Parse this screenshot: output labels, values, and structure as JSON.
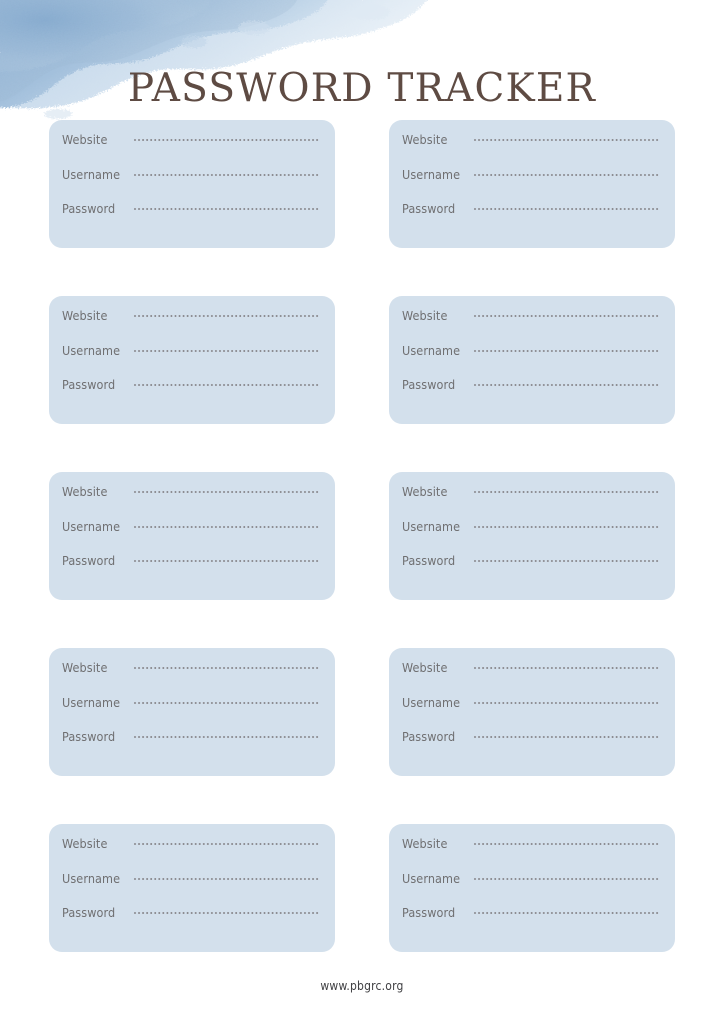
{
  "page": {
    "title": "PASSWORD TRACKER",
    "background_color": "#ffffff",
    "title_color": "#5e4b43"
  },
  "decoration": {
    "watercolor_splash": {
      "name": "watercolor-splash",
      "colors": [
        "#8cafd2",
        "#a8c3de",
        "#c6d9ea",
        "#e2ecf5"
      ],
      "position": "top-left"
    }
  },
  "card_style": {
    "background_color": "#d3e0ec",
    "label_color": "#6f6f71",
    "dot_color": "#8b8b90"
  },
  "field_labels": {
    "website": "Website",
    "username": "Username",
    "password": "Password"
  },
  "field_values": {
    "website": "",
    "username": "",
    "password": ""
  },
  "rows": [
    {
      "cards": [
        {
          "fields": [
            {
              "label": "Website",
              "value": ""
            },
            {
              "label": "Username",
              "value": ""
            },
            {
              "label": "Password",
              "value": ""
            }
          ]
        },
        {
          "fields": [
            {
              "label": "Website",
              "value": ""
            },
            {
              "label": "Username",
              "value": ""
            },
            {
              "label": "Password",
              "value": ""
            }
          ]
        }
      ]
    },
    {
      "cards": [
        {
          "fields": [
            {
              "label": "Website",
              "value": ""
            },
            {
              "label": "Username",
              "value": ""
            },
            {
              "label": "Password",
              "value": ""
            }
          ]
        },
        {
          "fields": [
            {
              "label": "Website",
              "value": ""
            },
            {
              "label": "Username",
              "value": ""
            },
            {
              "label": "Password",
              "value": ""
            }
          ]
        }
      ]
    },
    {
      "cards": [
        {
          "fields": [
            {
              "label": "Website",
              "value": ""
            },
            {
              "label": "Username",
              "value": ""
            },
            {
              "label": "Password",
              "value": ""
            }
          ]
        },
        {
          "fields": [
            {
              "label": "Website",
              "value": ""
            },
            {
              "label": "Username",
              "value": ""
            },
            {
              "label": "Password",
              "value": ""
            }
          ]
        }
      ]
    },
    {
      "cards": [
        {
          "fields": [
            {
              "label": "Website",
              "value": ""
            },
            {
              "label": "Username",
              "value": ""
            },
            {
              "label": "Password",
              "value": ""
            }
          ]
        },
        {
          "fields": [
            {
              "label": "Website",
              "value": ""
            },
            {
              "label": "Username",
              "value": ""
            },
            {
              "label": "Password",
              "value": ""
            }
          ]
        }
      ]
    },
    {
      "cards": [
        {
          "fields": [
            {
              "label": "Website",
              "value": ""
            },
            {
              "label": "Username",
              "value": ""
            },
            {
              "label": "Password",
              "value": ""
            }
          ]
        },
        {
          "fields": [
            {
              "label": "Website",
              "value": ""
            },
            {
              "label": "Username",
              "value": ""
            },
            {
              "label": "Password",
              "value": ""
            }
          ]
        }
      ]
    }
  ],
  "footer": {
    "url": "www.pbgrc.org"
  }
}
